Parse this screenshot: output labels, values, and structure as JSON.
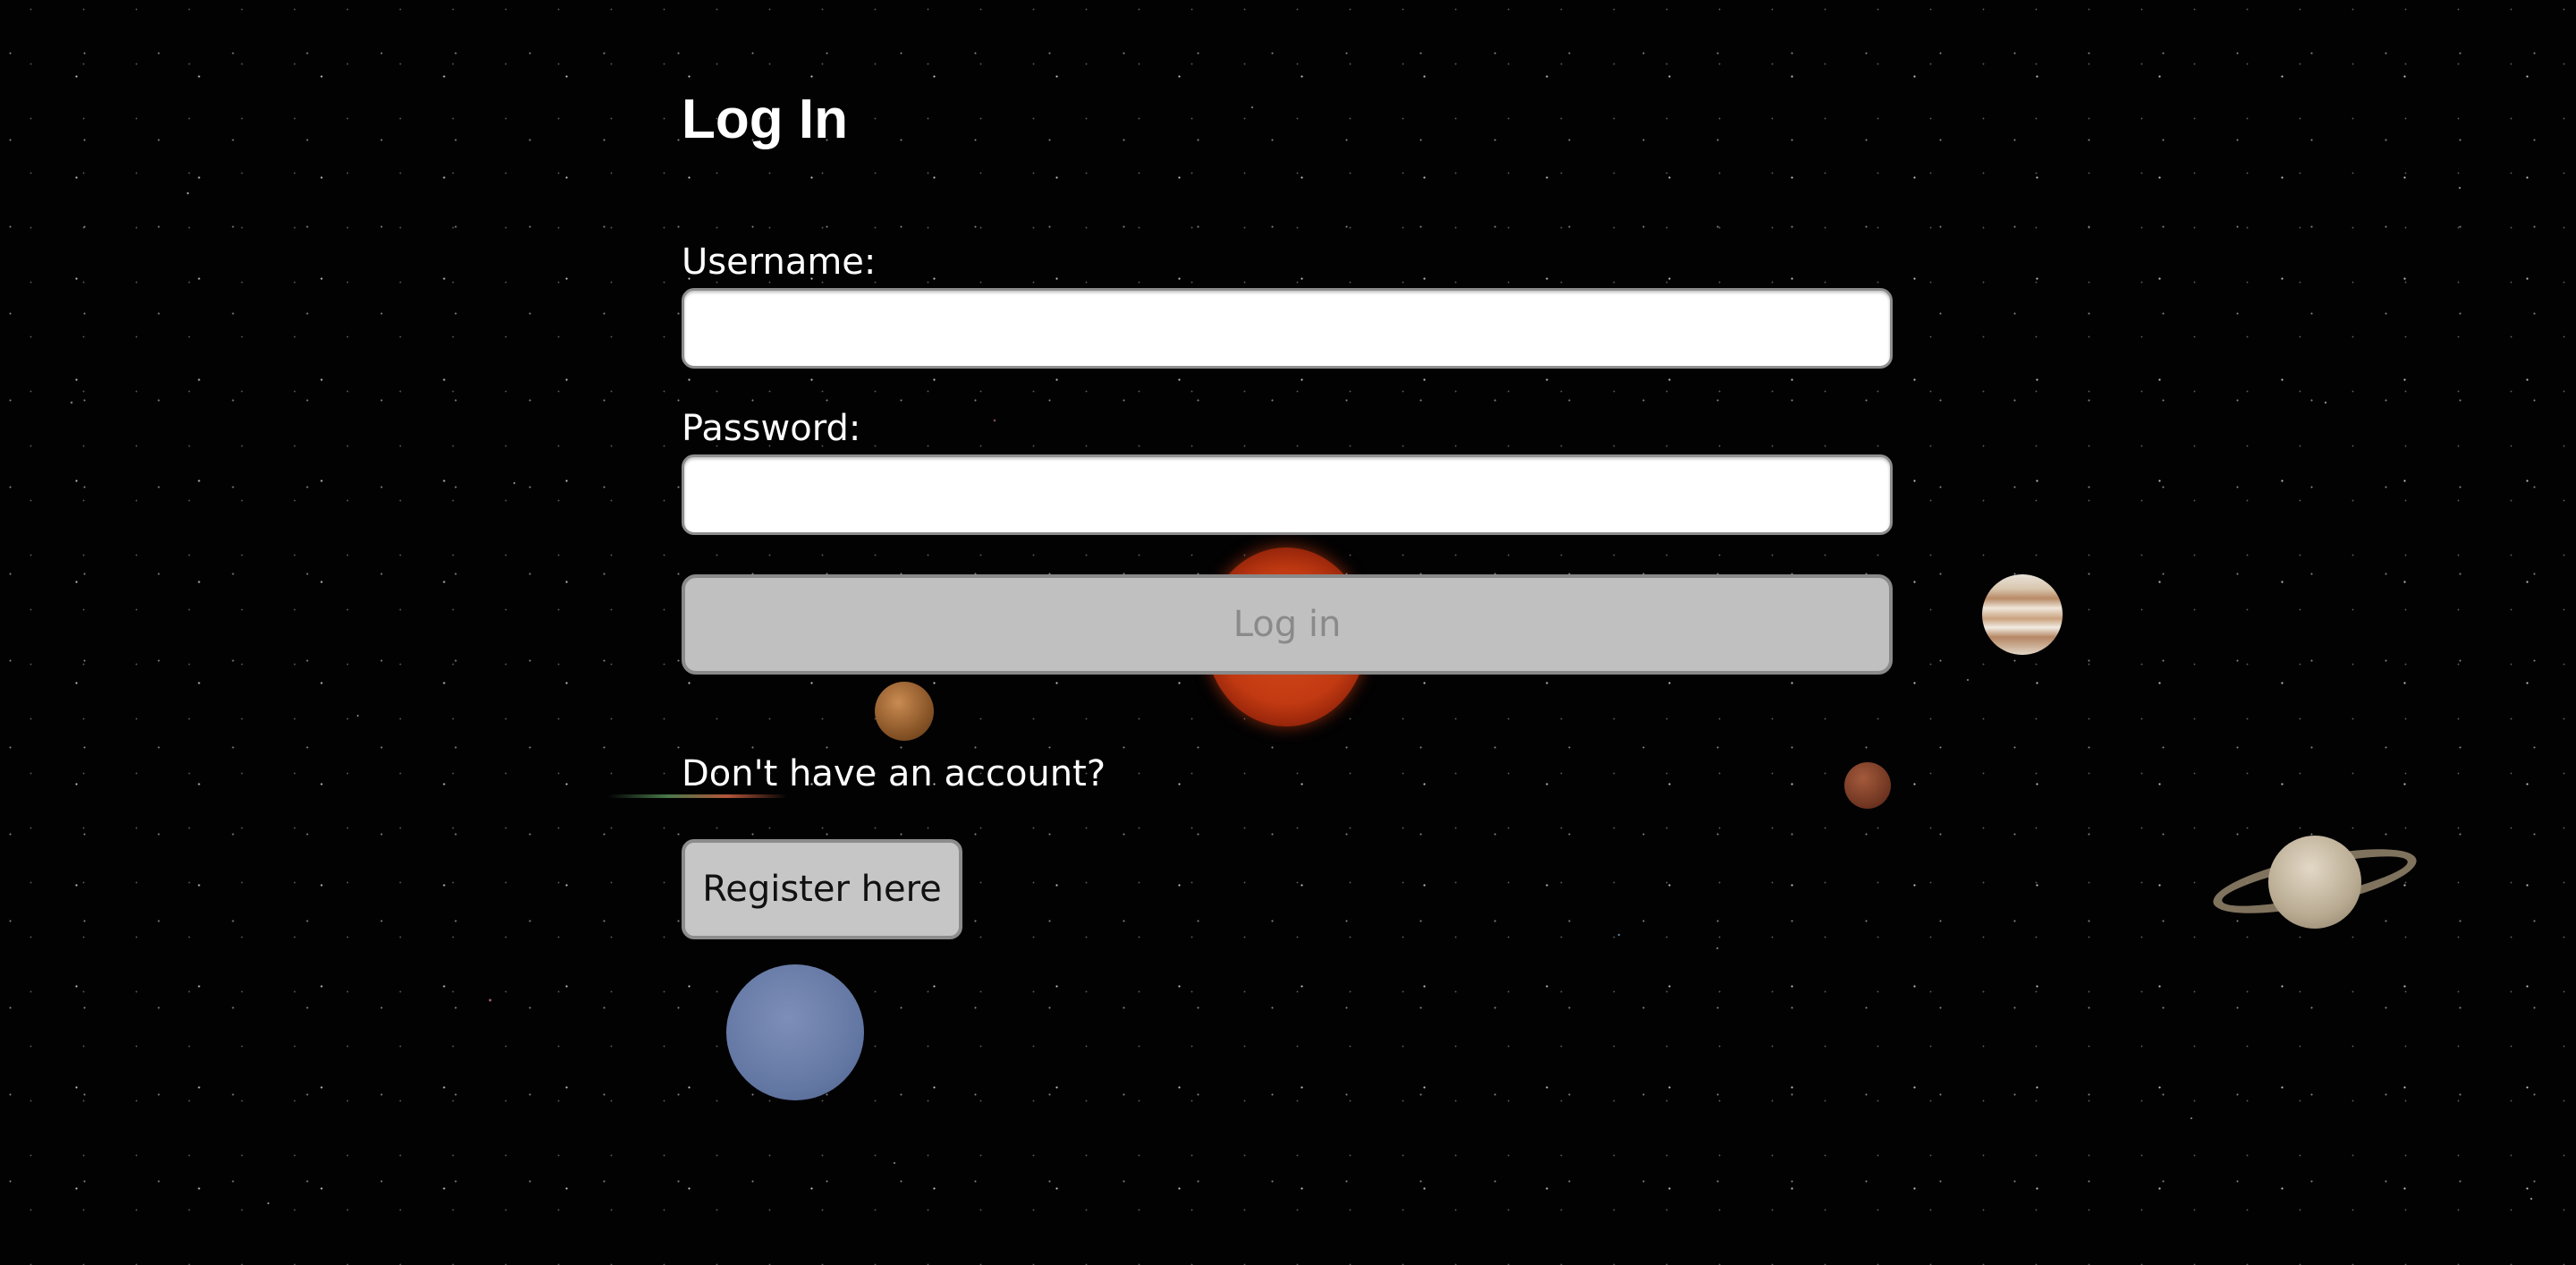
{
  "page": {
    "title": "Log In"
  },
  "form": {
    "username_label": "Username:",
    "username_value": "",
    "password_label": "Password:",
    "password_value": "",
    "login_button": "Log in",
    "login_button_disabled": true
  },
  "register": {
    "prompt": "Don't have an account?",
    "button": "Register here"
  },
  "background": {
    "theme": "space",
    "objects": [
      "sun-image",
      "venus-image",
      "mars-image",
      "jupiter-image",
      "saturn-image",
      "neptune-image"
    ]
  }
}
